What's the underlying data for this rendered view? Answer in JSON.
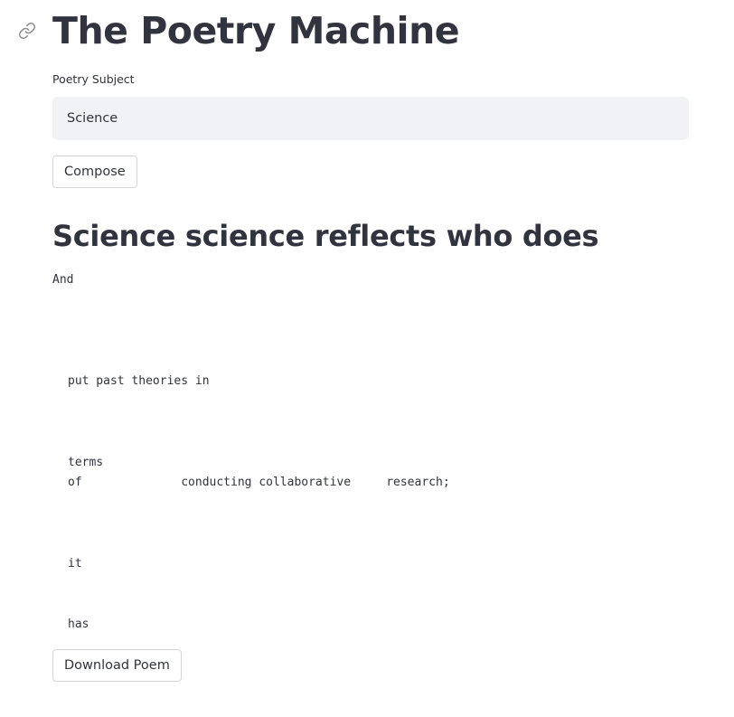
{
  "header": {
    "title": "The Poetry Machine",
    "anchor_icon": "link-icon"
  },
  "subject_field": {
    "label": "Poetry Subject",
    "value": "Science"
  },
  "compose_button": {
    "label": "Compose"
  },
  "poem": {
    "title": "Science science reflects who does",
    "lines": [
      "And",
      "put past theories in",
      "terms",
      "of              conducting collaborative     research;",
      "it",
      "has"
    ]
  },
  "download_button": {
    "label": "Download Poem"
  }
}
